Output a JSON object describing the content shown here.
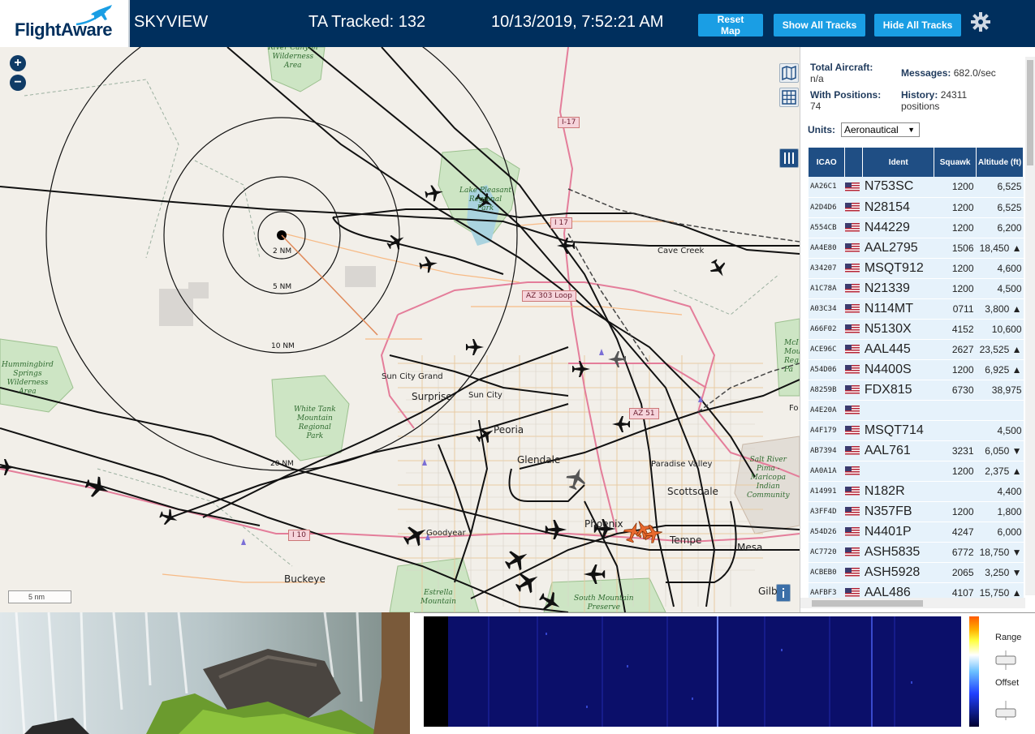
{
  "header": {
    "brand": "FlightAware",
    "app_name": "SKYVIEW",
    "tracked": "TA Tracked: 132",
    "datetime": "10/13/2019, 7:52:21 AM",
    "buttons": {
      "reset": "Reset Map",
      "show_all": "Show All Tracks",
      "hide_all": "Hide All Tracks"
    }
  },
  "map": {
    "zoom_in": "+",
    "zoom_out": "−",
    "scale": "5 nm",
    "rings": [
      "2 NM",
      "5 NM",
      "10 NM",
      "20 NM"
    ],
    "places": {
      "cave_creek": "Cave Creek",
      "sun_city_grand": "Sun City Grand",
      "surprise": "Surprise",
      "sun_city": "Sun City",
      "peoria": "Peoria",
      "glendale": "Glendale",
      "paradise_valley": "Paradise Valley",
      "scottsdale": "Scottsdale",
      "phoenix": "Phoenix",
      "tempe": "Tempe",
      "mesa": "Mesa",
      "buckeye": "Buckeye",
      "goodyear": "Goodyear",
      "gilbert": "Gilb",
      "fo": "Fo"
    },
    "parks": {
      "river_canyon": "River Canyon\nWilderness\nArea",
      "lake_pleasant": "Lake Pleasant\nRegional\nPark",
      "hummingbird": "Hummingbird\nSprings\nWilderness\nArea",
      "white_tank": "White Tank\nMountain\nRegional\nPark",
      "salt_river": "Salt River\nPima -\nMaricopa\nIndian\nCommunity",
      "estrella": "Estrella\nMountain",
      "south_mountain": "South Mountain\nPreserve",
      "mcdowell": "McI\nMou\nReg\nPa"
    },
    "highways": {
      "i17_a": "I-17",
      "i17_b": "I 17",
      "az303": "AZ 303 Loop",
      "az51": "AZ 51",
      "i10": "I 10"
    }
  },
  "panel": {
    "total_aircraft_label": "Total Aircraft:",
    "total_aircraft_value": "n/a",
    "with_positions_label": "With Positions:",
    "with_positions_value": "74",
    "messages_label": "Messages:",
    "messages_value": "682.0/sec",
    "history_label": "History:",
    "history_value": "24311",
    "history_unit": "positions",
    "units_label": "Units:",
    "units_value": "Aeronautical",
    "columns": [
      "ICAO",
      "",
      "Ident",
      "Squawk",
      "Altitude (ft)"
    ],
    "rows": [
      {
        "icao": "AA26C1",
        "ident": "N753SC",
        "squawk": "1200",
        "alt": "6,525"
      },
      {
        "icao": "A2D4D6",
        "ident": "N28154",
        "squawk": "1200",
        "alt": "6,525"
      },
      {
        "icao": "A554CB",
        "ident": "N44229",
        "squawk": "1200",
        "alt": "6,200"
      },
      {
        "icao": "AA4E80",
        "ident": "AAL2795",
        "squawk": "1506",
        "alt": "18,450 ▲"
      },
      {
        "icao": "A34207",
        "ident": "MSQT912",
        "squawk": "1200",
        "alt": "4,600"
      },
      {
        "icao": "A1C78A",
        "ident": "N21339",
        "squawk": "1200",
        "alt": "4,500"
      },
      {
        "icao": "A03C34",
        "ident": "N114MT",
        "squawk": "0711",
        "alt": "3,800 ▲"
      },
      {
        "icao": "A66F02",
        "ident": "N5130X",
        "squawk": "4152",
        "alt": "10,600"
      },
      {
        "icao": "ACE96C",
        "ident": "AAL445",
        "squawk": "2627",
        "alt": "23,525 ▲"
      },
      {
        "icao": "A54D06",
        "ident": "N4400S",
        "squawk": "1200",
        "alt": "6,925 ▲"
      },
      {
        "icao": "A8259B",
        "ident": "FDX815",
        "squawk": "6730",
        "alt": "38,975"
      },
      {
        "icao": "A4E20A",
        "ident": "",
        "squawk": "",
        "alt": ""
      },
      {
        "icao": "A4F179",
        "ident": "MSQT714",
        "squawk": "",
        "alt": "4,500"
      },
      {
        "icao": "AB7394",
        "ident": "AAL761",
        "squawk": "3231",
        "alt": "6,050 ▼"
      },
      {
        "icao": "AA0A1A",
        "ident": "",
        "squawk": "1200",
        "alt": "2,375 ▲"
      },
      {
        "icao": "A14991",
        "ident": "N182R",
        "squawk": "",
        "alt": "4,400"
      },
      {
        "icao": "A3FF4D",
        "ident": "N357FB",
        "squawk": "1200",
        "alt": "1,800"
      },
      {
        "icao": "A54D26",
        "ident": "N4401P",
        "squawk": "4247",
        "alt": "6,000"
      },
      {
        "icao": "AC7720",
        "ident": "ASH5835",
        "squawk": "6772",
        "alt": "18,750 ▼"
      },
      {
        "icao": "ACBEB0",
        "ident": "ASH5928",
        "squawk": "2065",
        "alt": "3,250 ▼"
      },
      {
        "icao": "AAFBF3",
        "ident": "AAL486",
        "squawk": "4107",
        "alt": "15,750 ▲"
      }
    ]
  },
  "spectrum": {
    "range_label": "Range",
    "offset_label": "Offset"
  },
  "colors": {
    "header_bg": "#002f5d",
    "button": "#1a9ee4",
    "table_header": "#1f4e84",
    "row_bg": "#e6f2fb"
  }
}
